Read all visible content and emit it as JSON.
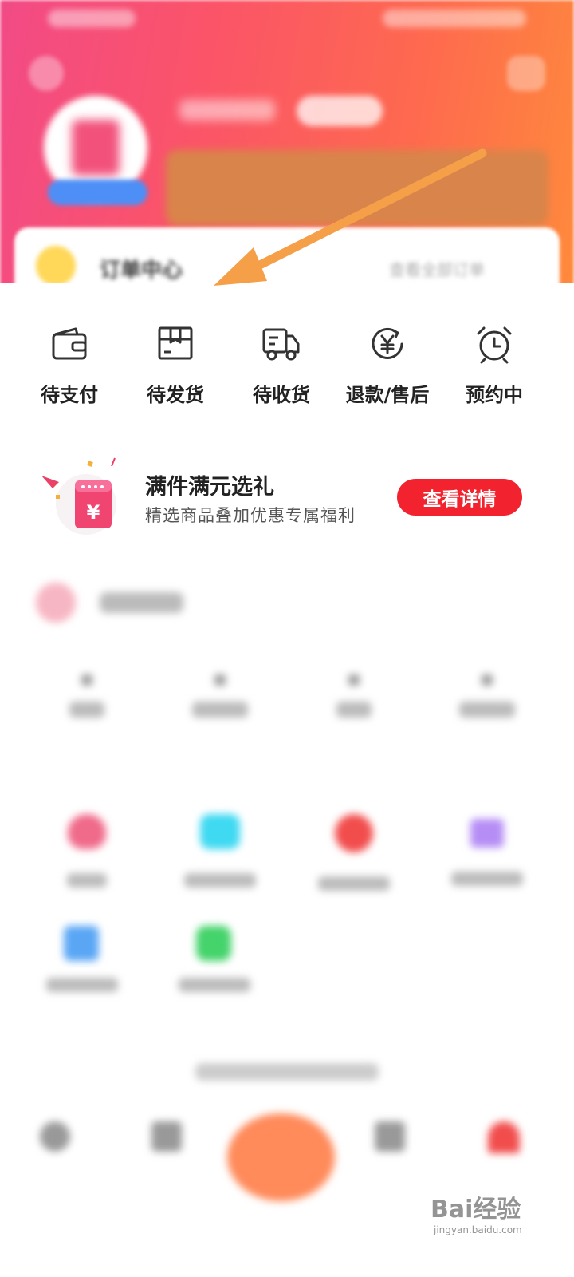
{
  "order_statuses": [
    {
      "label": "待支付",
      "icon": "wallet-icon"
    },
    {
      "label": "待发货",
      "icon": "package-icon"
    },
    {
      "label": "待收货",
      "icon": "delivery-truck-icon"
    },
    {
      "label": "退款/售后",
      "icon": "refund-yen-icon"
    },
    {
      "label": "预约中",
      "icon": "alarm-clock-icon"
    }
  ],
  "promo_gift": {
    "title": "满件满元选礼",
    "subtitle": "精选商品叠加优惠专属福利",
    "button": "查看详情",
    "icon_glyph": "¥"
  },
  "blurred_header": {
    "order_center_title": "订单中心",
    "order_center_link": "查看全部订单"
  },
  "watermark": {
    "brand": "Bai经验",
    "url": "jingyan.baidu.com"
  },
  "colors": {
    "accent_red": "#f2232f",
    "header_gradient_start": "#f24a86",
    "header_gradient_end": "#ff8a3c",
    "arrow": "#f5a049"
  }
}
